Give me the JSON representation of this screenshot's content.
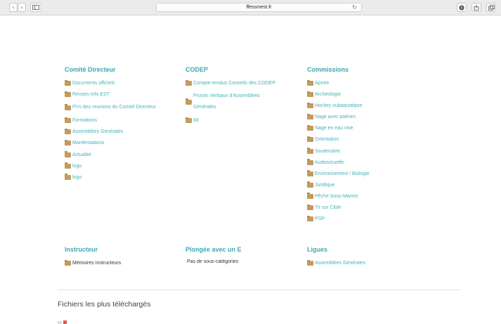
{
  "browser": {
    "url": "ffessmest.fr",
    "back_glyph": "‹",
    "forward_glyph": "›",
    "reload_glyph": "↻",
    "icons": [
      "back-icon",
      "forward-icon",
      "sidebar-icon",
      "reload-icon",
      "download-icon",
      "share-icon",
      "tabs-icon"
    ]
  },
  "columns": [
    {
      "title": "Comité Directeur",
      "items": [
        "Documents officiels",
        "Revues Info EST",
        "PVs des reunions du Comité Directeur",
        "Formations",
        "Assemblées Générales",
        "Manifestations",
        "Actualité",
        "logo",
        "logo"
      ]
    },
    {
      "title": "CODEP",
      "items": [
        "Compte-rendus Conseils des CODEP",
        "Procès Verbaux d'Assemblées Générales",
        "68"
      ]
    },
    {
      "title": "Commissions",
      "items": [
        "Apnée",
        "Archéologie",
        "Hockey subaquatique",
        "Nage avec palmes",
        "Nage en eau vive",
        "Orientation",
        "Souterraine",
        "Audiovisuelle",
        "Environnement / Biologie",
        "Juridique",
        "Pêche Sous-Marine",
        "Tir sur Cible",
        "PSP"
      ]
    },
    {
      "title": "Instructeur",
      "items": [
        "Mémoires Instructeurs"
      ]
    },
    {
      "title": "Plongée avec un E",
      "note": "Pas de sous-catégories"
    },
    {
      "title": "Ligues",
      "items": [
        "Assemblées Générales"
      ]
    }
  ],
  "most_downloaded": {
    "title": "Fichiers les plus téléchargés"
  },
  "colors": {
    "accent": "#3aaab0",
    "link": "#45b2b8",
    "folder": "#c49a5e",
    "pdf": "#e25555"
  }
}
